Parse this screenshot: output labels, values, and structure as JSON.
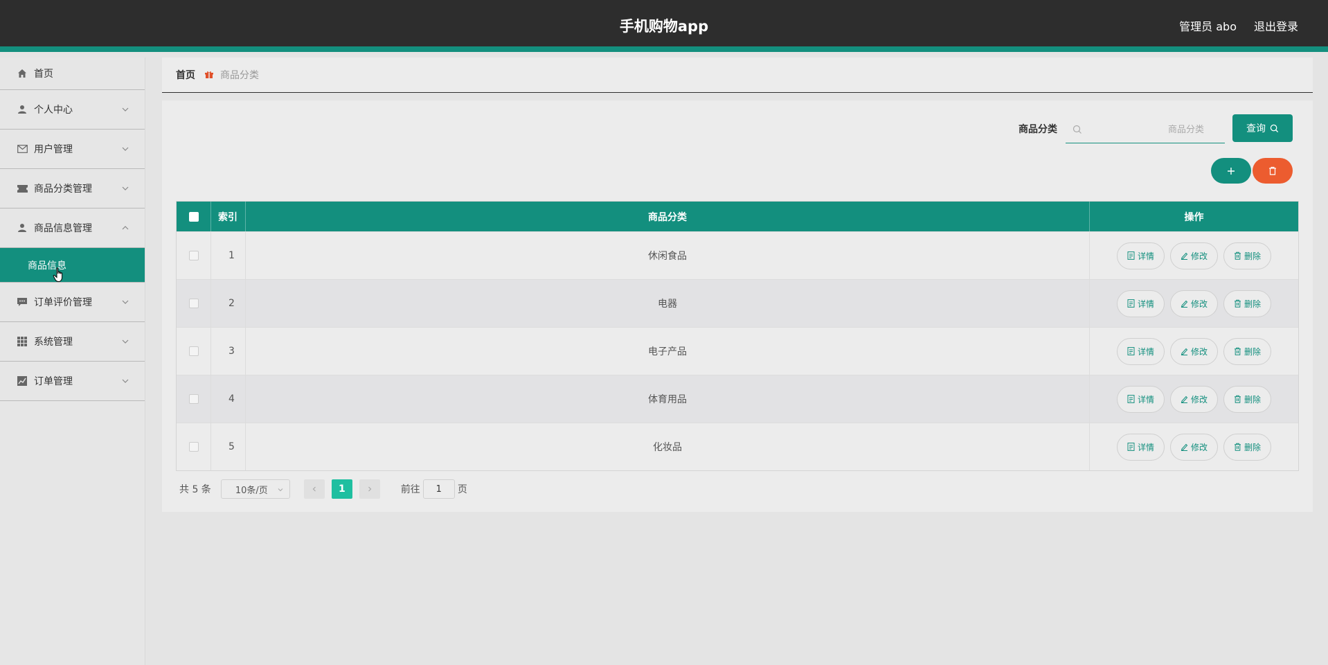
{
  "header": {
    "title": "手机购物app",
    "admin": "管理员 abo",
    "logout": "退出登录"
  },
  "sidebar": {
    "items": [
      {
        "label": "首页",
        "icon": "home-icon"
      },
      {
        "label": "个人中心",
        "icon": "person-icon"
      },
      {
        "label": "用户管理",
        "icon": "mail-icon"
      },
      {
        "label": "商品分类管理",
        "icon": "ticket-icon"
      },
      {
        "label": "商品信息管理",
        "icon": "person-icon"
      },
      {
        "label": "订单评价管理",
        "icon": "chat-icon"
      },
      {
        "label": "系统管理",
        "icon": "grid-icon"
      },
      {
        "label": "订单管理",
        "icon": "chart-icon"
      }
    ],
    "submenu": {
      "label": "商品信息"
    }
  },
  "breadcrumb": {
    "home": "首页",
    "current": "商品分类"
  },
  "search": {
    "label": "商品分类",
    "placeholder": "商品分类",
    "button": "查询"
  },
  "table": {
    "headers": {
      "index": "索引",
      "category": "商品分类",
      "actions": "操作"
    },
    "rows": [
      {
        "index": "1",
        "category": "休闲食品"
      },
      {
        "index": "2",
        "category": "电器"
      },
      {
        "index": "3",
        "category": "电子产品"
      },
      {
        "index": "4",
        "category": "体育用品"
      },
      {
        "index": "5",
        "category": "化妆品"
      }
    ],
    "actions": {
      "detail": "详情",
      "edit": "修改",
      "delete": "删除"
    }
  },
  "pagination": {
    "total": "共 5 条",
    "page_size": "10条/页",
    "current_page": "1",
    "goto_prefix": "前往",
    "goto_value": "1",
    "goto_suffix": "页"
  },
  "colors": {
    "primary": "#138f7e",
    "danger": "#ec5c2f",
    "topbar": "#2d2d2d",
    "active_page": "#1fbfa0"
  }
}
